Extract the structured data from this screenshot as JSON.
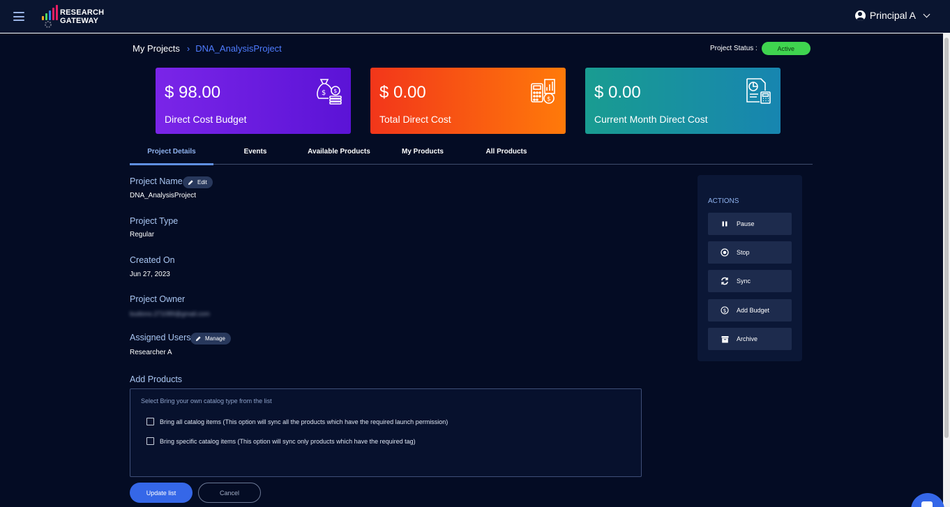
{
  "header": {
    "logo_line1": "RESEARCH",
    "logo_line2": "GATEWAY",
    "user_name": "Principal A"
  },
  "breadcrumb": {
    "root": "My Projects",
    "separator": "›",
    "current": "DNA_AnalysisProject"
  },
  "project_status": {
    "label": "Project Status :",
    "value": "Active"
  },
  "cost_cards": [
    {
      "amount": "$ 98.00",
      "label": "Direct Cost Budget",
      "icon": "money-bag-coins-icon"
    },
    {
      "amount": "$ 0.00",
      "label": "Total Direct Cost",
      "icon": "calculator-coin-icon"
    },
    {
      "amount": "$ 0.00",
      "label": "Current Month Direct Cost",
      "icon": "report-calculator-icon"
    }
  ],
  "tabs": [
    {
      "label": "Project Details",
      "active": true
    },
    {
      "label": "Events",
      "active": false
    },
    {
      "label": "Available Products",
      "active": false
    },
    {
      "label": "My Products",
      "active": false
    },
    {
      "label": "All Products",
      "active": false
    }
  ],
  "details": {
    "project_name_label": "Project Name",
    "edit_label": "Edit",
    "project_name_value": "DNA_AnalysisProject",
    "project_type_label": "Project Type",
    "project_type_value": "Regular",
    "created_on_label": "Created On",
    "created_on_value": "Jun 27, 2023",
    "project_owner_label": "Project Owner",
    "project_owner_value": "budiono.271089@gmail.com",
    "assigned_users_label": "Assigned Users",
    "manage_label": "Manage",
    "assigned_users_value": "Researcher A"
  },
  "add_products": {
    "label": "Add Products",
    "hint": "Select Bring your own catalog type from the list",
    "options": [
      {
        "label": "Bring all catalog items (This option will sync all the products which have the required launch permission)",
        "checked": false
      },
      {
        "label": "Bring specific catalog items (This option will sync only products which have the required tag)",
        "checked": false
      }
    ],
    "update_label": "Update list",
    "cancel_label": "Cancel"
  },
  "actions": {
    "title": "ACTIONS",
    "items": [
      {
        "label": "Pause",
        "icon": "pause-icon"
      },
      {
        "label": "Stop",
        "icon": "stop-circle-icon"
      },
      {
        "label": "Sync",
        "icon": "sync-icon"
      },
      {
        "label": "Add Budget",
        "icon": "dollar-circle-icon"
      },
      {
        "label": "Archive",
        "icon": "archive-icon"
      }
    ]
  },
  "colors": {
    "background": "#040c24",
    "topbar": "#0a1530",
    "accent_blue": "#3567e8",
    "link_blue": "#4f7cff",
    "status_green": "#3fd44f",
    "card_purple": "#6a1de0",
    "card_orange": "#f8541a",
    "card_teal": "#188fa3"
  }
}
